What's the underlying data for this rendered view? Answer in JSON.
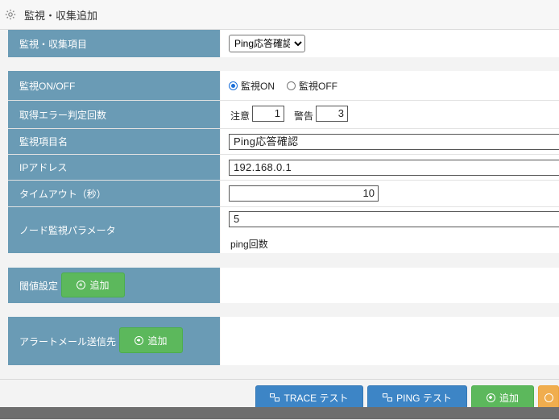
{
  "window": {
    "title": "監視・収集追加",
    "gear_icon": "gear-icon"
  },
  "monitor_item": {
    "label": "監視・収集項目",
    "selected": "Ping応答確認"
  },
  "monitor_onoff": {
    "label": "監視ON/OFF",
    "on_label": "監視ON",
    "off_label": "監視OFF",
    "selected": "on"
  },
  "error_count": {
    "label": "取得エラー判定回数",
    "caution_label": "注意",
    "caution_value": "1",
    "warning_label": "警告",
    "warning_value": "3"
  },
  "item_name": {
    "label": "監視項目名",
    "value": "Ping応答確認"
  },
  "ip_address": {
    "label": "IPアドレス",
    "value": "192.168.0.1"
  },
  "timeout": {
    "label": "タイムアウト（秒）",
    "value": "10"
  },
  "node_param": {
    "label": "ノード監視パラメータ",
    "value": "5",
    "hint": "ping回数"
  },
  "threshold": {
    "label": "閾値設定",
    "add_label": "追加"
  },
  "alert_mail": {
    "label": "アラートメール送信先",
    "add_label": "追加"
  },
  "footer": {
    "trace_label": "TRACE テスト",
    "ping_label": "PING テスト",
    "add_label": "追加"
  },
  "colors": {
    "label_bg": "#6a9bb5",
    "green": "#5cb85c",
    "blue": "#3d85c6",
    "orange": "#f0ad4e"
  }
}
